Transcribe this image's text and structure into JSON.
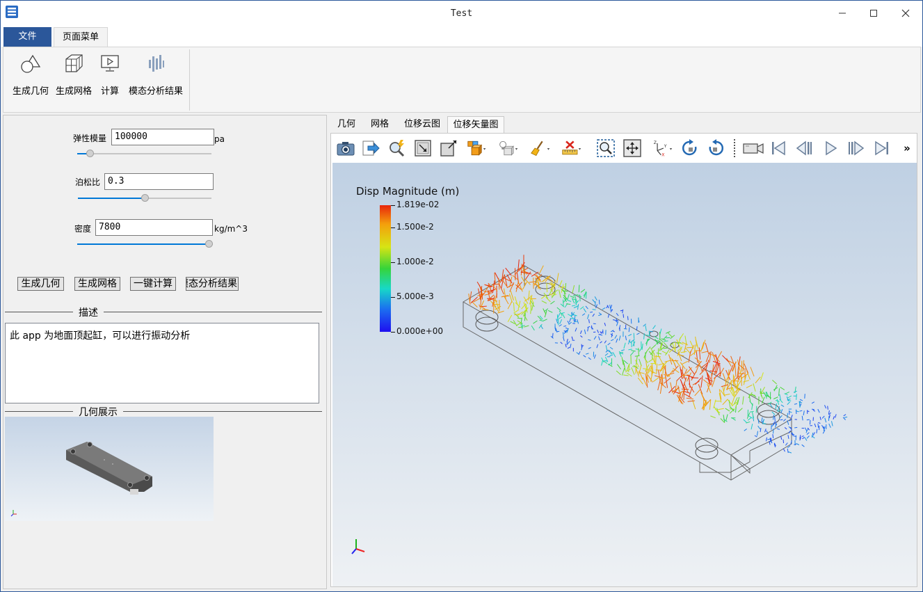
{
  "window": {
    "title": "Test"
  },
  "ribbon": {
    "tabs": [
      {
        "label": "文件"
      },
      {
        "label": "页面菜单"
      }
    ],
    "buttons": [
      {
        "label": "生成几何",
        "icon": "geometry-icon"
      },
      {
        "label": "生成网格",
        "icon": "mesh-icon"
      },
      {
        "label": "计算",
        "icon": "compute-icon"
      },
      {
        "label": "模态分析结果",
        "icon": "modal-results-icon"
      }
    ]
  },
  "params": {
    "elastic": {
      "label": "弹性模量",
      "value": "100000",
      "unit": "pa",
      "slider": 0.07
    },
    "poisson": {
      "label": "泊松比",
      "value": "0.3",
      "unit": "",
      "slider": 0.5
    },
    "density": {
      "label": "密度",
      "value": "7800",
      "unit": "kg/m^3",
      "slider": 1.0
    }
  },
  "actions": [
    {
      "label": "生成几何"
    },
    {
      "label": "生成网格"
    },
    {
      "label": "一键计算"
    },
    {
      "label": "模态分析结果"
    }
  ],
  "description": {
    "title": "描述",
    "text": "此 app 为地面顶起缸，可以进行振动分析"
  },
  "geometry": {
    "title": "几何展示"
  },
  "viewer": {
    "tabs": [
      {
        "label": "几何"
      },
      {
        "label": "网格"
      },
      {
        "label": "位移云图"
      },
      {
        "label": "位移矢量图"
      }
    ],
    "active_tab": "位移矢量图",
    "more": "»"
  },
  "legend": {
    "title": "Disp Magnitude (m)",
    "ticks": [
      {
        "label": "1.819e-02",
        "value": 0.01819
      },
      {
        "label": "1.500e-2",
        "value": 0.015
      },
      {
        "label": "1.000e-2",
        "value": 0.01
      },
      {
        "label": "5.000e-3",
        "value": 0.005
      },
      {
        "label": "0.000e+00",
        "value": 0.0
      }
    ],
    "max": 0.01819
  },
  "colors": {
    "accent": "#2b579a",
    "slider": "#0078d7"
  }
}
